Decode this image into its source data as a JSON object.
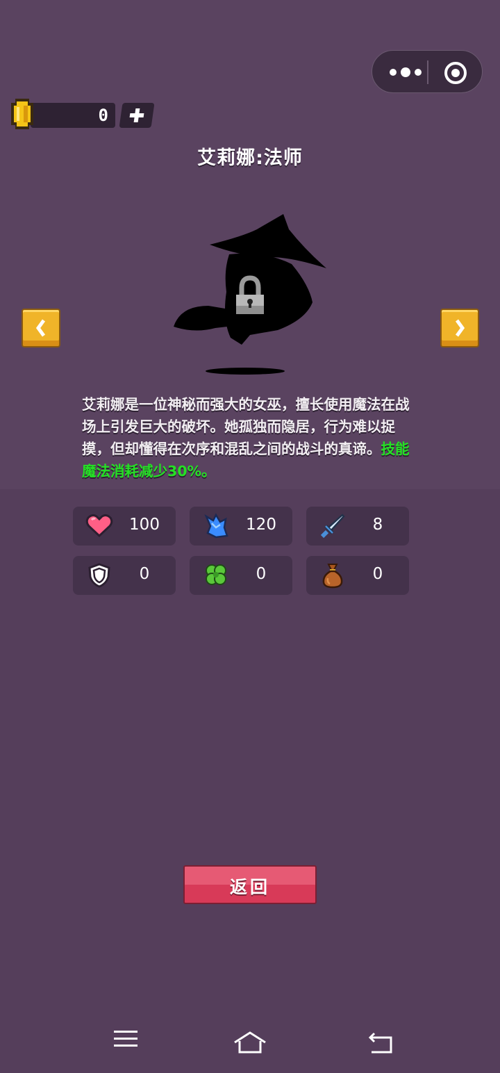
{
  "coins": {
    "value": "0"
  },
  "character": {
    "title": "艾莉娜:法师",
    "description_main": "艾莉娜是一位神秘而强大的女巫，擅长使用魔法在战场上引发巨大的破坏。她孤独而隐居，行为难以捉摸，但却懂得在次序和混乱之间的战斗的真谛。",
    "description_skill": "技能魔法消耗减少30%。",
    "locked": true
  },
  "stats": [
    {
      "icon": "heart-icon",
      "value": "100"
    },
    {
      "icon": "mana-crystal-icon",
      "value": "120"
    },
    {
      "icon": "sword-icon",
      "value": "8"
    },
    {
      "icon": "shield-icon",
      "value": "0"
    },
    {
      "icon": "clover-icon",
      "value": "0"
    },
    {
      "icon": "money-bag-icon",
      "value": "0"
    }
  ],
  "buttons": {
    "back": "返回"
  },
  "colors": {
    "background": "#58415e",
    "skill_highlight": "#25e025",
    "back_button": "#d83a58",
    "arrow_button": "#f0b429"
  }
}
